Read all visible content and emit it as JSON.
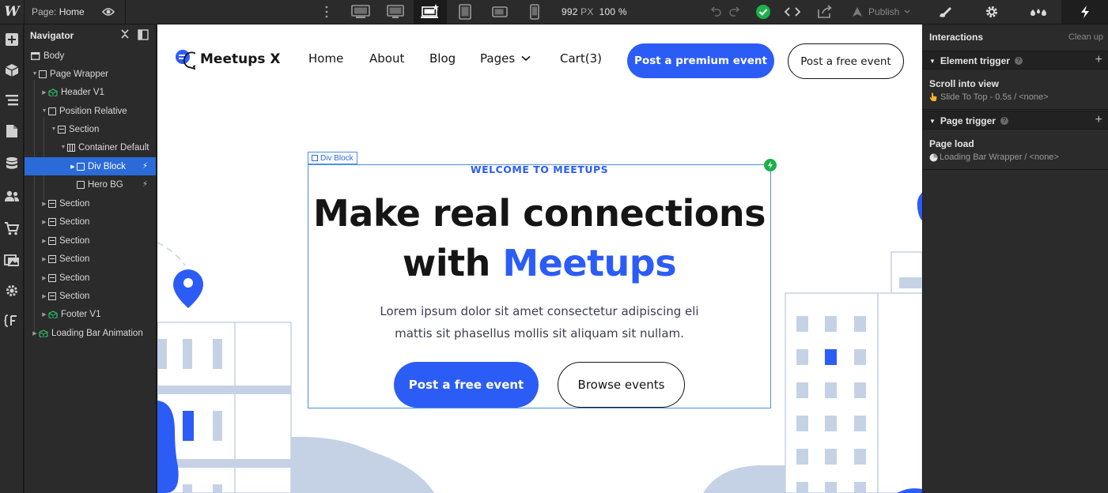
{
  "topbar": {
    "logo": "W",
    "page_prefix": "Page:",
    "page_name": "Home",
    "canvas_width": "992",
    "canvas_unit": "PX",
    "zoom": "100 %",
    "publish_label": "Publish",
    "status_color": "#1bb24a"
  },
  "navigator": {
    "title": "Navigator",
    "tree": [
      {
        "label": "Body",
        "icon": "body"
      },
      {
        "label": "Page Wrapper",
        "icon": "box"
      },
      {
        "label": "Header V1",
        "icon": "component"
      },
      {
        "label": "Position Relative",
        "icon": "box"
      },
      {
        "label": "Section",
        "icon": "section"
      },
      {
        "label": "Container Default",
        "icon": "container"
      },
      {
        "label": "Div Block",
        "icon": "box"
      },
      {
        "label": "Hero BG",
        "icon": "box"
      },
      {
        "label": "Section",
        "icon": "section"
      },
      {
        "label": "Section",
        "icon": "section"
      },
      {
        "label": "Section",
        "icon": "section"
      },
      {
        "label": "Section",
        "icon": "section"
      },
      {
        "label": "Section",
        "icon": "section"
      },
      {
        "label": "Section",
        "icon": "section"
      },
      {
        "label": "Footer V1",
        "icon": "component"
      },
      {
        "label": "Loading Bar Animation",
        "icon": "component"
      }
    ]
  },
  "site": {
    "logo_text": "Meetups X",
    "menu": [
      "Home",
      "About",
      "Blog",
      "Pages",
      "Cart(3)"
    ],
    "btn_premium": "Post a premium event",
    "btn_free_top": "Post a free event",
    "div_tag": "Div Block",
    "eyebrow": "WELCOME TO MEETUPS",
    "headline_line1": "Make real connections",
    "headline_line2a": "with ",
    "headline_line2b": "Meetups",
    "lead_line1": "Lorem ipsum dolor sit amet consectetur adipiscing eli",
    "lead_line2": "mattis sit phasellus mollis sit aliquam sit nullam.",
    "btn_post_free": "Post a free event",
    "btn_browse": "Browse events",
    "brand_color": "#2c5cf6"
  },
  "panel": {
    "title": "Interactions",
    "clean_up": "Clean up",
    "element_trigger": {
      "label": "Element trigger",
      "item_title": "Scroll into view",
      "item_sub": "Slide To Top - 0.5s / <none>"
    },
    "page_trigger": {
      "label": "Page trigger",
      "item_title": "Page load",
      "item_sub": "Loading Bar Wrapper / <none>"
    }
  }
}
